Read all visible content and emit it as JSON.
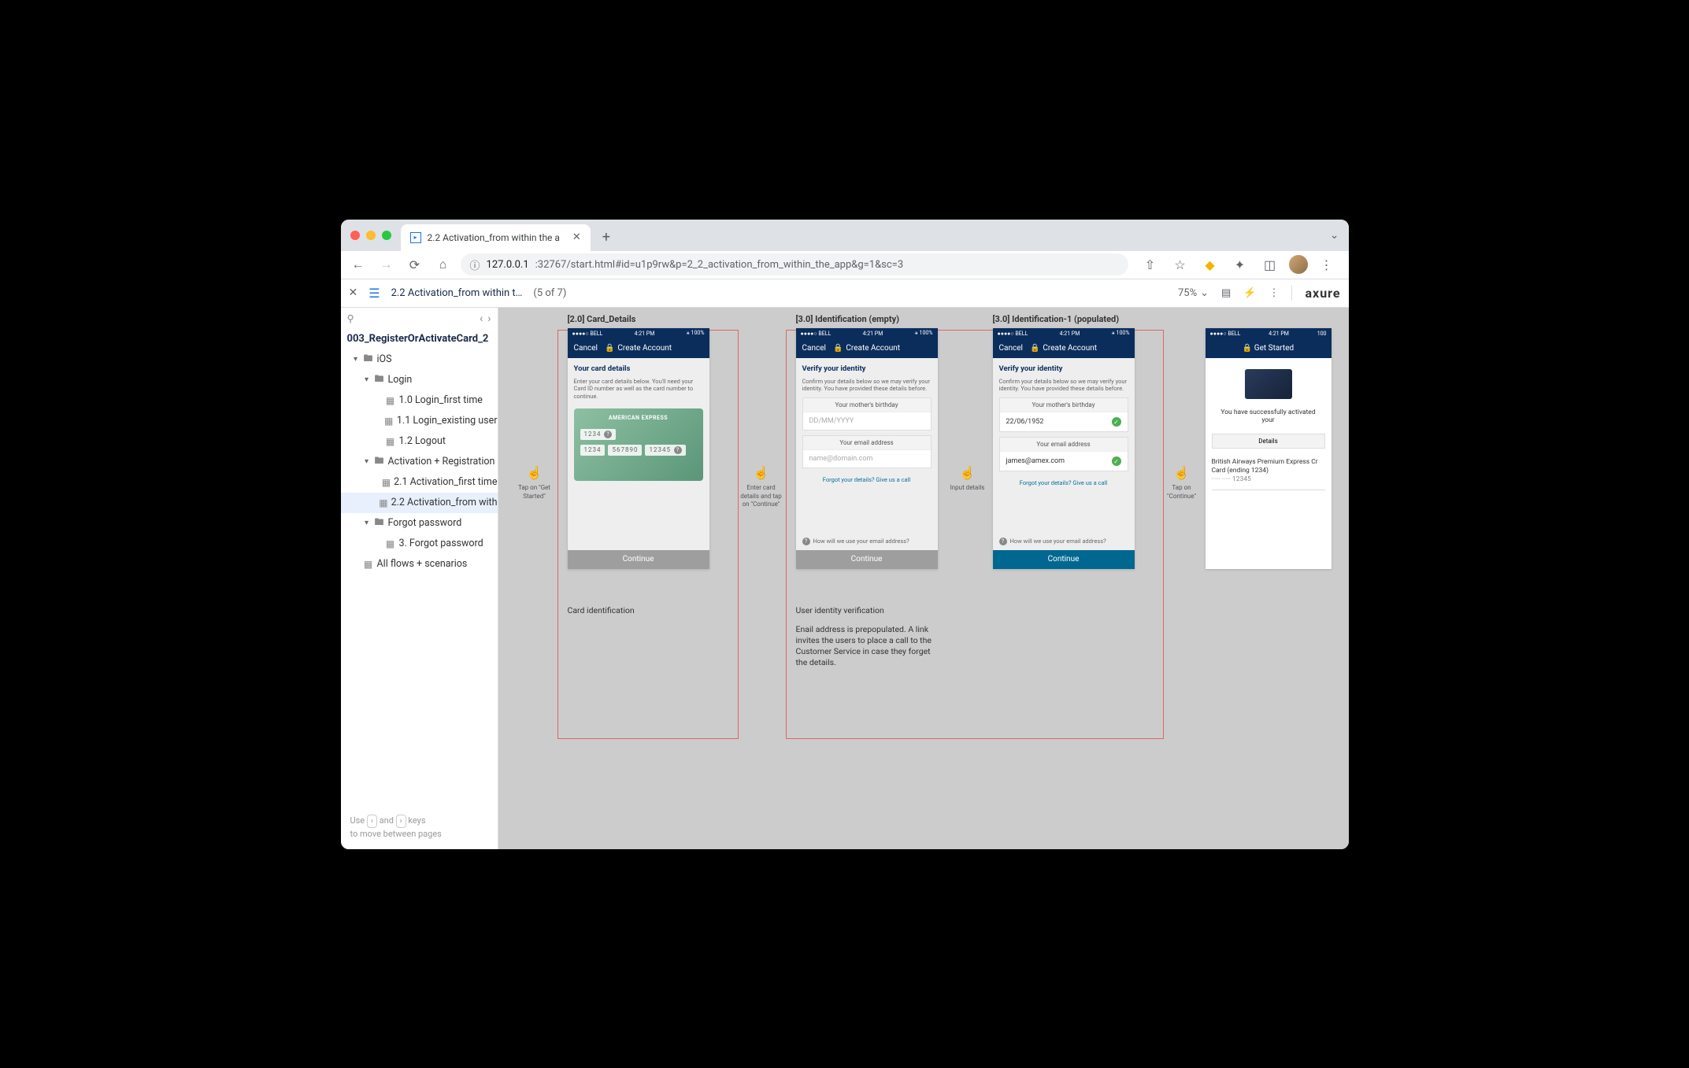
{
  "window": {
    "tab_title": "2.2 Activation_from within the a",
    "url_host": "127.0.0.1",
    "url_port_path": ":32767/start.html#id=u1p9rw&p=2_2_activation_from_within_the_app&g=1&sc=3"
  },
  "axure": {
    "page_title": "2.2 Activation_from within t…",
    "page_count": "(5 of 7)",
    "zoom": "75%",
    "logo": "axure"
  },
  "sidebar": {
    "project": "003_RegisterOrActivateCard_2",
    "hint1": "Use",
    "hint_and": "and",
    "hint_keys": "keys",
    "hint2": "to move between pages",
    "tree": {
      "ios": "iOS",
      "login": "Login",
      "login_1": "1.0 Login_first time",
      "login_2": "1.1 Login_existing user",
      "login_3": "1.2 Logout",
      "activation": "Activation + Registration",
      "act_1": "2.1 Activation_first time",
      "act_2": "2.2 Activation_from with",
      "forgot": "Forgot password",
      "forgot_1": "3. Forgot password",
      "all": "All flows + scenarios"
    }
  },
  "screens": {
    "status_carrier": "●●●●○ BELL",
    "status_wifi": "⚲",
    "status_time": "4:21 PM",
    "status_bt": "⚹ 100%",
    "cancel": "Cancel",
    "s1": {
      "title": "[2.0] Card_Details",
      "nav": "Create Account",
      "h": "Your card details",
      "sub": "Enter your card details below. You'll need your Card ID number as well as the card number to continue.",
      "brand": "AMERICAN EXPRESS",
      "slot1": "1234",
      "slot2a": "1234",
      "slot2b": "567890",
      "slot2c": "12345",
      "btn": "Continue",
      "caption": "Card identification"
    },
    "s2": {
      "title": "[3.0] Identification (empty)",
      "nav": "Create Account",
      "h": "Verify your identity",
      "sub": "Confirm your details below so we may verify your identity. You have provided these details before.",
      "f1_label": "Your mother's birthday",
      "f1_ph": "DD/MM/YYYY",
      "f2_label": "Your email address",
      "f2_ph": "name@domain.com",
      "link": "Forgot your details? Give us a call",
      "info": "How will we use your email address?",
      "btn": "Continue",
      "caption": "User identity verification",
      "caption2": "Enail address is prepopulated. A link invites the users to place a call to the Customer Service in case they forget the details."
    },
    "s3": {
      "title": "[3.0] Identification-1 (populated)",
      "nav": "Create Account",
      "h": "Verify your identity",
      "sub": "Confirm your details below so we may verify your identity. You have provided these details before.",
      "f1_label": "Your mother's birthday",
      "f1_val": "22/06/1952",
      "f2_label": "Your email address",
      "f2_val": "james@amex.com",
      "link": "Forgot your details? Give us a call",
      "info": "How will we use your email address?",
      "btn": "Continue"
    },
    "s4": {
      "nav": "Get Started",
      "succ": "You have successfully activated your",
      "details": "Details",
      "card_name": "British Airways Premium Express Cr",
      "card_ending": "Card (ending 1234)",
      "card_mask": "····· ····· 12345"
    }
  },
  "arrows": {
    "a1": "Tap on \"Get Started\"",
    "a2": "Enter card details and tap on \"Continue\"",
    "a3": "Input details",
    "a4": "Tap on \"Continue\""
  }
}
